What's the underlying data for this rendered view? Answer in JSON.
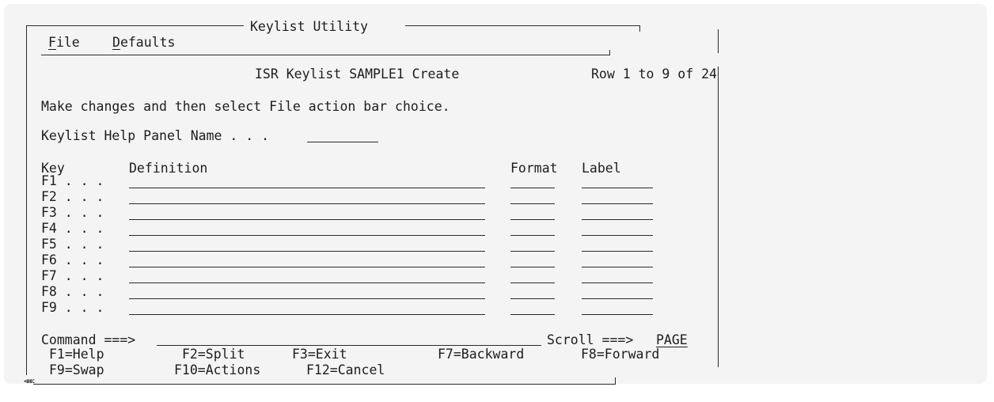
{
  "window": {
    "title": "Keylist Utility"
  },
  "menu": {
    "file": "File",
    "defaults": "Defaults"
  },
  "panel": {
    "title": "ISR Keylist SAMPLE1 Create",
    "row_info": "Row 1 to 9 of 24",
    "instruction": "Make changes and then select File action bar choice.",
    "help_panel_label": "Keylist Help Panel Name . . .",
    "help_panel_value": ""
  },
  "columns": {
    "key": "Key",
    "definition": "Definition",
    "format": "Format",
    "label": "Label"
  },
  "keys": [
    "F1 . . .",
    "F2 . . .",
    "F3 . . .",
    "F4 . . .",
    "F5 . . .",
    "F6 . . .",
    "F7 . . .",
    "F8 . . .",
    "F9 . . ."
  ],
  "command": {
    "label": "Command ===>",
    "value": "",
    "scroll_label": "Scroll ===>",
    "scroll_value": "PAGE"
  },
  "fkeys": {
    "f1": "F1=Help",
    "f2": "F2=Split",
    "f3": "F3=Exit",
    "f7": "F7=Backward",
    "f8": "F8=Forward",
    "f9": "F9=Swap",
    "f10": "F10=Actions",
    "f12": "F12=Cancel"
  },
  "nav_glyph": "<<<"
}
